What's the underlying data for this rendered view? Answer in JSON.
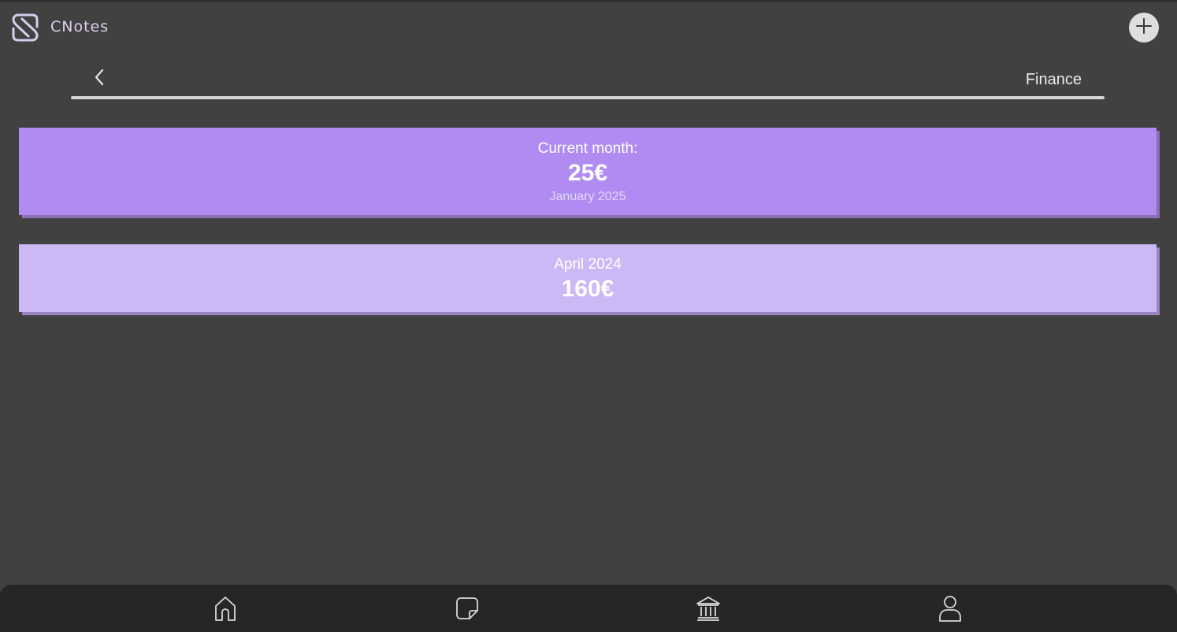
{
  "app": {
    "title": "CNotes",
    "logo_icon": "cnotes-logo-icon",
    "add_icon": "plus-icon"
  },
  "subnav": {
    "title": "Finance",
    "back_icon": "chevron-left-icon"
  },
  "current_month": {
    "label": "Current month:",
    "amount": "25€",
    "date": "January 2025"
  },
  "months": [
    {
      "label": "April 2024",
      "amount": "160€"
    }
  ],
  "bottom_nav": [
    {
      "name": "home",
      "icon": "home-icon"
    },
    {
      "name": "notes",
      "icon": "note-icon"
    },
    {
      "name": "finance",
      "icon": "bank-icon"
    },
    {
      "name": "profile",
      "icon": "user-icon"
    }
  ],
  "colors": {
    "background": "#414141",
    "accent": "#b08cf2",
    "accent_light": "#cdb8f6",
    "nav_bar": "#262626"
  }
}
